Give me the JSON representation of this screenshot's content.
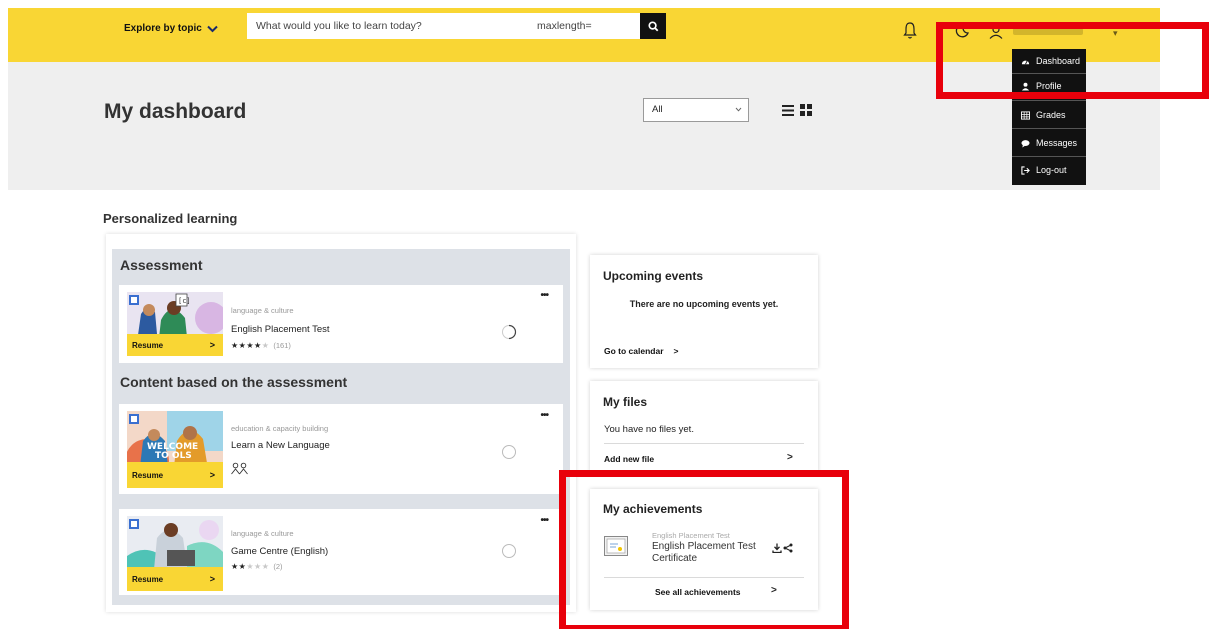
{
  "topbar": {
    "explore_label": "Explore by topic",
    "search_placeholder": "What would you like to learn today?",
    "search_extra": "maxlength="
  },
  "user_menu": {
    "items": [
      {
        "label": "Dashboard",
        "icon": "dashboard-icon"
      },
      {
        "label": "Profile",
        "icon": "profile-icon"
      },
      {
        "label": "Grades",
        "icon": "grades-icon"
      },
      {
        "label": "Messages",
        "icon": "messages-icon"
      },
      {
        "label": "Log-out",
        "icon": "logout-icon"
      }
    ]
  },
  "header": {
    "title": "My dashboard",
    "filter_value": "All"
  },
  "main": {
    "section_title": "Personalized learning",
    "assessment_title": "Assessment",
    "content_title": "Content based on the assessment",
    "courses": [
      {
        "category": "language & culture",
        "title": "English Placement Test",
        "resume": "Resume",
        "rating": 4,
        "count": "(161)"
      },
      {
        "category": "education & capacity building",
        "title": "Learn a New Language",
        "resume": "Resume"
      },
      {
        "category": "language & culture",
        "title": "Game Centre (English)",
        "resume": "Resume",
        "rating": 2,
        "count": "(2)"
      }
    ]
  },
  "sidebar": {
    "events": {
      "title": "Upcoming events",
      "empty": "There are no upcoming events yet.",
      "link": "Go to calendar"
    },
    "files": {
      "title": "My files",
      "empty": "You have no files yet.",
      "link": "Add new file"
    },
    "achievements": {
      "title": "My achievements",
      "item_course": "English Placement Test",
      "item_title": "English Placement Test Certificate",
      "link": "See all achievements"
    }
  },
  "colors": {
    "brand_yellow": "#f9d634",
    "highlight_red": "#e8000b",
    "menu_black": "#111111"
  }
}
